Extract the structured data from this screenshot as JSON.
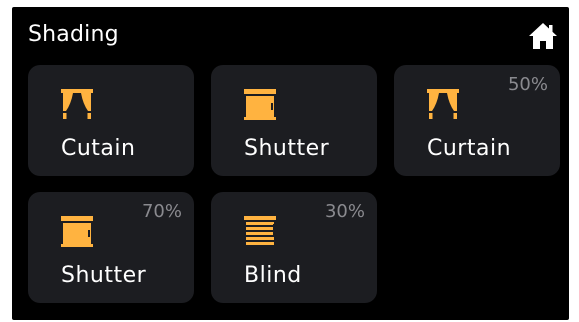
{
  "header": {
    "title": "Shading",
    "home_icon": "home-icon"
  },
  "colors": {
    "background": "#000000",
    "tile": "#1c1d21",
    "accent": "#ffb340",
    "text": "#ffffff",
    "muted": "#8a8a8f"
  },
  "tiles": [
    {
      "label": "Cutain",
      "icon": "curtain-icon",
      "level": ""
    },
    {
      "label": "Shutter",
      "icon": "shutter-icon",
      "level": ""
    },
    {
      "label": "Curtain",
      "icon": "curtain-icon",
      "level": "50%"
    },
    {
      "label": "Shutter",
      "icon": "shutter-icon",
      "level": "70%"
    },
    {
      "label": "Blind",
      "icon": "blind-icon",
      "level": "30%"
    }
  ]
}
